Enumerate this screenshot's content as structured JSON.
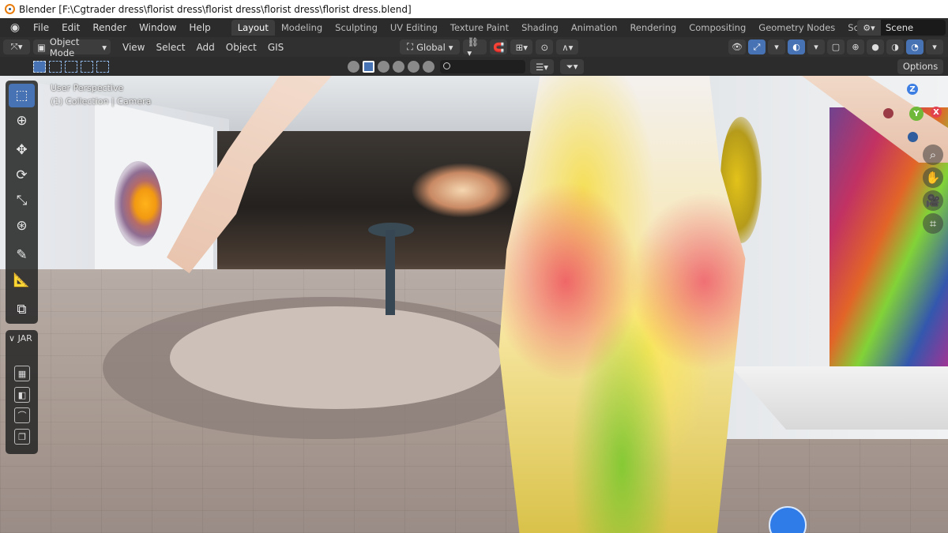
{
  "window": {
    "title": "Blender [F:\\Cgtrader dress\\florist dress\\florist dress\\florist dress\\florist dress.blend]"
  },
  "menus": [
    "File",
    "Edit",
    "Render",
    "Window",
    "Help"
  ],
  "workspaces": [
    "Layout",
    "Modeling",
    "Sculpting",
    "UV Editing",
    "Texture Paint",
    "Shading",
    "Animation",
    "Rendering",
    "Compositing",
    "Geometry Nodes",
    "Scripting"
  ],
  "active_workspace": "Layout",
  "scene": {
    "name": "Scene"
  },
  "header": {
    "mode": "Object Mode",
    "menus": [
      "View",
      "Select",
      "Add",
      "Object",
      "GIS"
    ],
    "transform_orientation": "Global"
  },
  "tool_settings": {
    "options_label": "Options"
  },
  "viewport": {
    "perspective_label": "User Perspective",
    "collection_label": "(1) Collection | Camera"
  },
  "side_panel": {
    "tab_label": "JAR"
  },
  "gizmo": {
    "x": "X",
    "y": "Y",
    "z": "Z"
  },
  "colors": {
    "accent": "#4772b3",
    "x_axis": "#e2424e",
    "y_axis": "#6fb83a",
    "z_axis": "#3d7ee3"
  }
}
